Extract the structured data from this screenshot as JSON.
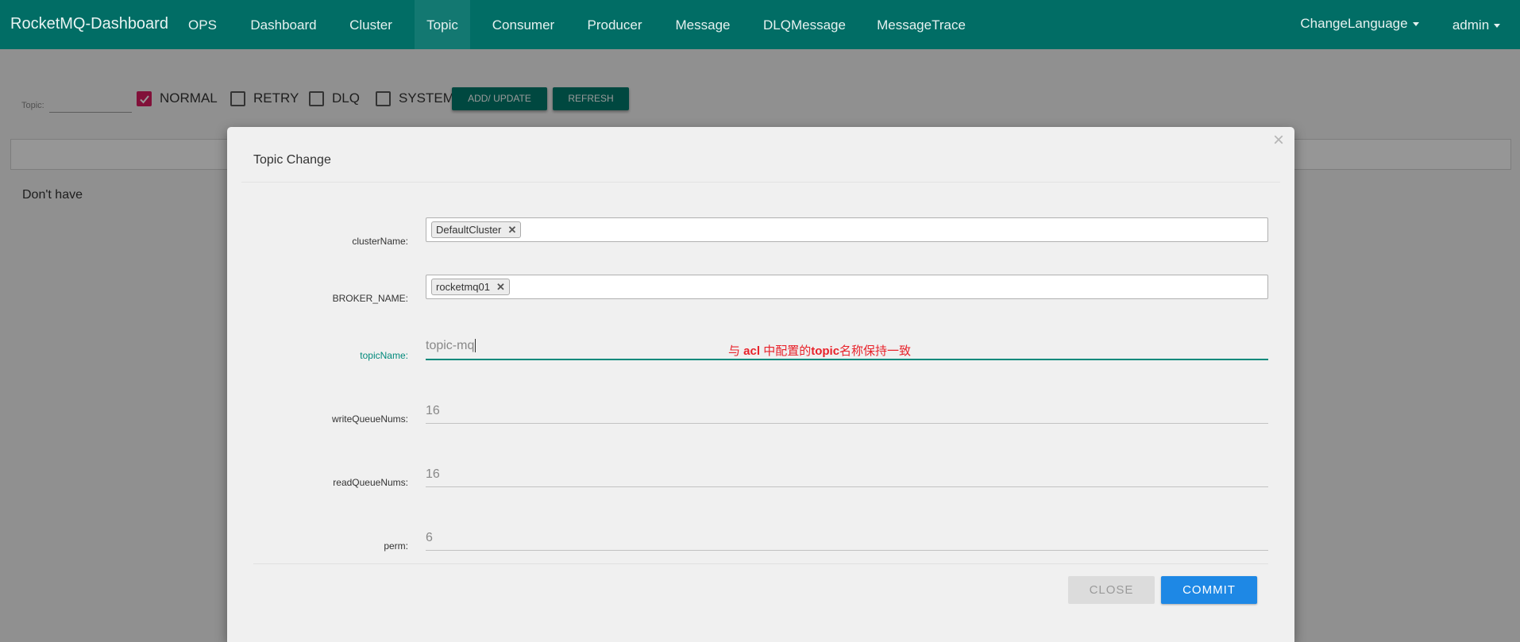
{
  "navbar": {
    "brand": "RocketMQ-Dashboard",
    "items": [
      {
        "label": "OPS"
      },
      {
        "label": "Dashboard"
      },
      {
        "label": "Cluster"
      },
      {
        "label": "Topic",
        "active": true
      },
      {
        "label": "Consumer"
      },
      {
        "label": "Producer"
      },
      {
        "label": "Message"
      },
      {
        "label": "DLQMessage"
      },
      {
        "label": "MessageTrace"
      }
    ],
    "change_language": "ChangeLanguage",
    "user": "admin",
    "bg_color": "#016d65"
  },
  "filter": {
    "topic_label": "Topic:",
    "topic_value": "",
    "checkboxes": [
      {
        "label": "NORMAL",
        "checked": true
      },
      {
        "label": "RETRY",
        "checked": false
      },
      {
        "label": "DLQ",
        "checked": false
      },
      {
        "label": "SYSTEM",
        "checked": false
      }
    ],
    "add_update_label": "ADD/ UPDATE",
    "refresh_label": "REFRESH"
  },
  "main": {
    "empty_text": "Don't have"
  },
  "modal": {
    "title": "Topic Change",
    "close_symbol": "×",
    "fields": {
      "cluster_name": {
        "label": "clusterName:",
        "tags": [
          "DefaultCluster"
        ]
      },
      "broker_name": {
        "label": "BROKER_NAME:",
        "tags": [
          "rocketmq01"
        ]
      },
      "topic_name": {
        "label": "topicName:",
        "value": "topic-mq"
      },
      "write_queue_nums": {
        "label": "writeQueueNums:",
        "value": "16"
      },
      "read_queue_nums": {
        "label": "readQueueNums:",
        "value": "16"
      },
      "perm": {
        "label": "perm:",
        "value": "6"
      }
    },
    "annotation": {
      "part1": "与 ",
      "part2": "acl",
      "part3": " 中配置的",
      "part4": "topic",
      "part5": "名称保持一致"
    },
    "close_label": "CLOSE",
    "commit_label": "COMMIT"
  },
  "colors": {
    "accent": "#00796b",
    "commit": "#1e88e5",
    "checkbox": "#d81b60",
    "annotation": "#e8222a"
  }
}
